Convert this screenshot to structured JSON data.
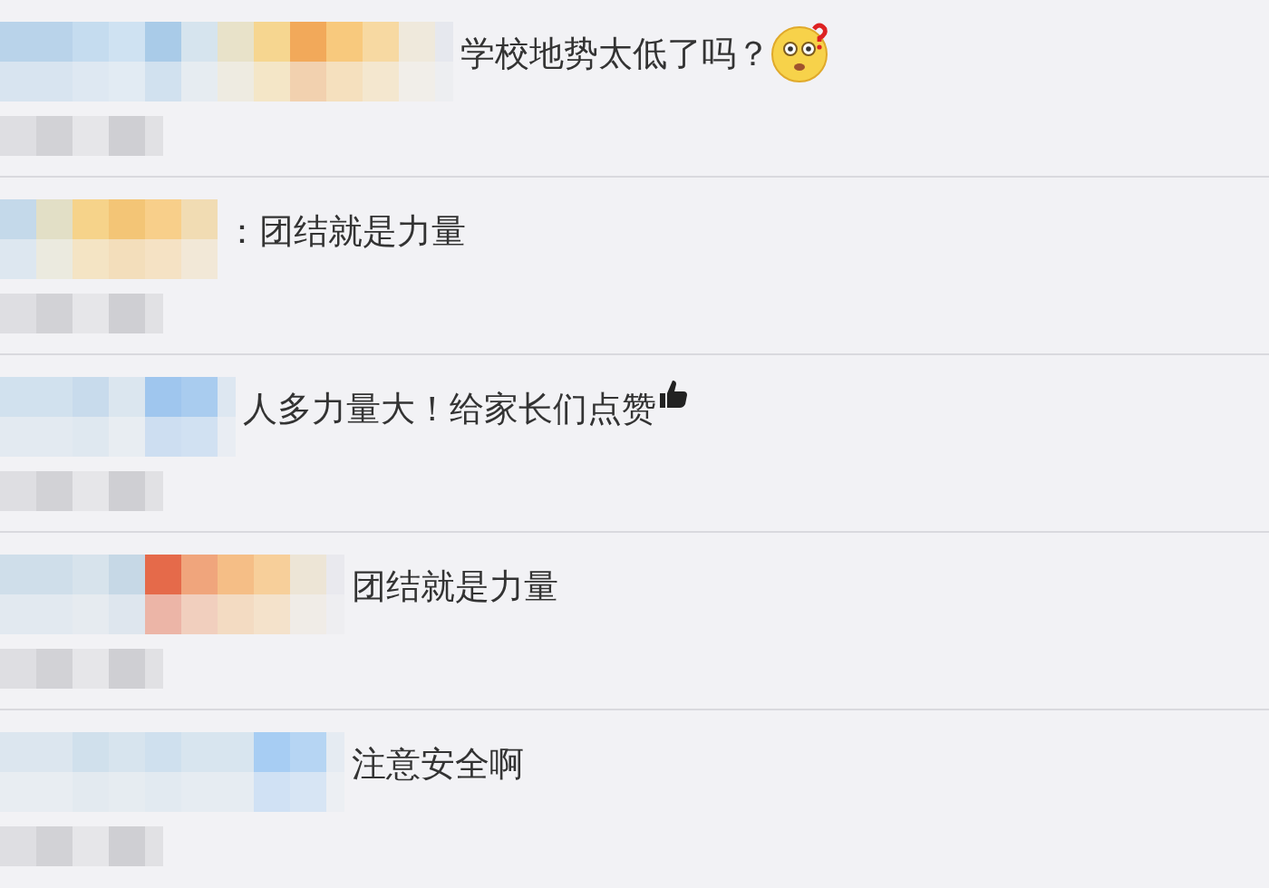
{
  "comments": [
    {
      "text": "学校地势太低了吗？",
      "kind": "puzzled"
    },
    {
      "text": "：团结就是力量",
      "kind": "plain"
    },
    {
      "text": "人多力量大！给家长们点赞",
      "kind": "thumbs"
    },
    {
      "text": "团结就是力量",
      "kind": "plain"
    },
    {
      "text": "注意安全啊",
      "kind": "plain"
    }
  ]
}
